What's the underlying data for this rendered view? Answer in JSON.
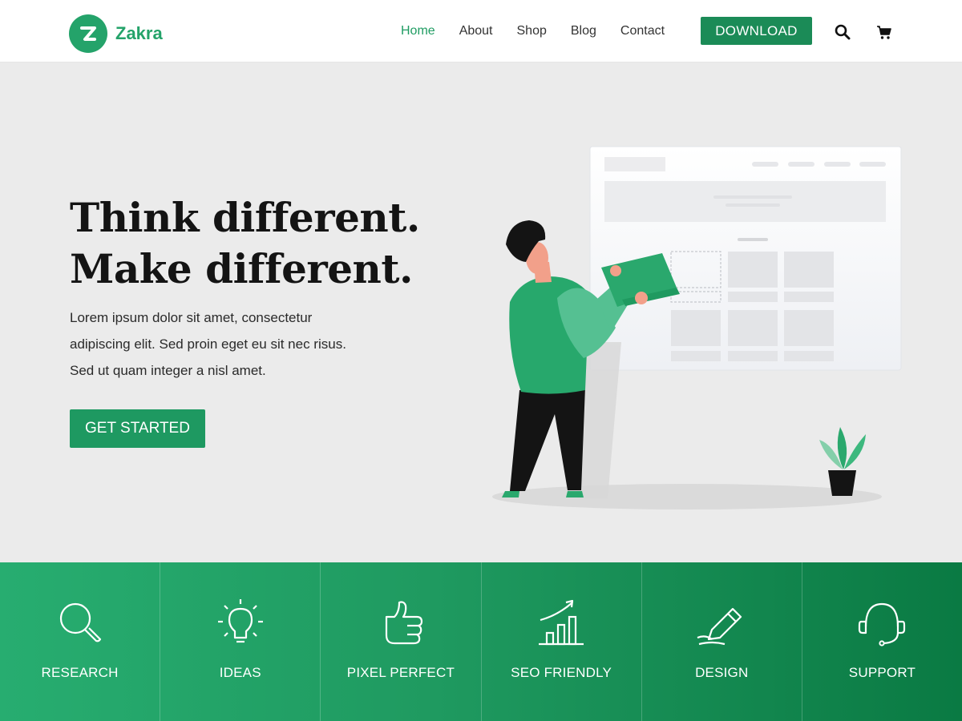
{
  "header": {
    "brand": "Zakra",
    "nav": [
      "Home",
      "About",
      "Shop",
      "Blog",
      "Contact"
    ],
    "download_label": "DOWNLOAD",
    "icons": [
      "search-icon",
      "cart-icon"
    ]
  },
  "hero": {
    "title_line1": "Think different.",
    "title_line2": "Make different.",
    "body_line1": "Lorem ipsum dolor sit amet, consectetur",
    "body_line2": "adipiscing elit. Sed proin eget eu sit nec risus.",
    "body_line3": "Sed ut quam integer a nisl amet.",
    "cta_label": "GET STARTED"
  },
  "features": [
    {
      "label": "RESEARCH",
      "icon": "magnifier-icon"
    },
    {
      "label": "IDEAS",
      "icon": "lightbulb-icon"
    },
    {
      "label": "PIXEL PERFECT",
      "icon": "thumbs-up-icon"
    },
    {
      "label": "SEO FRIENDLY",
      "icon": "growth-chart-icon"
    },
    {
      "label": "DESIGN",
      "icon": "pencil-icon"
    },
    {
      "label": "SUPPORT",
      "icon": "headset-icon"
    }
  ],
  "colors": {
    "brand": "#24a36a",
    "brand_dark": "#1b8b57",
    "hero_bg": "#ebebeb",
    "text_dark": "#141414"
  }
}
